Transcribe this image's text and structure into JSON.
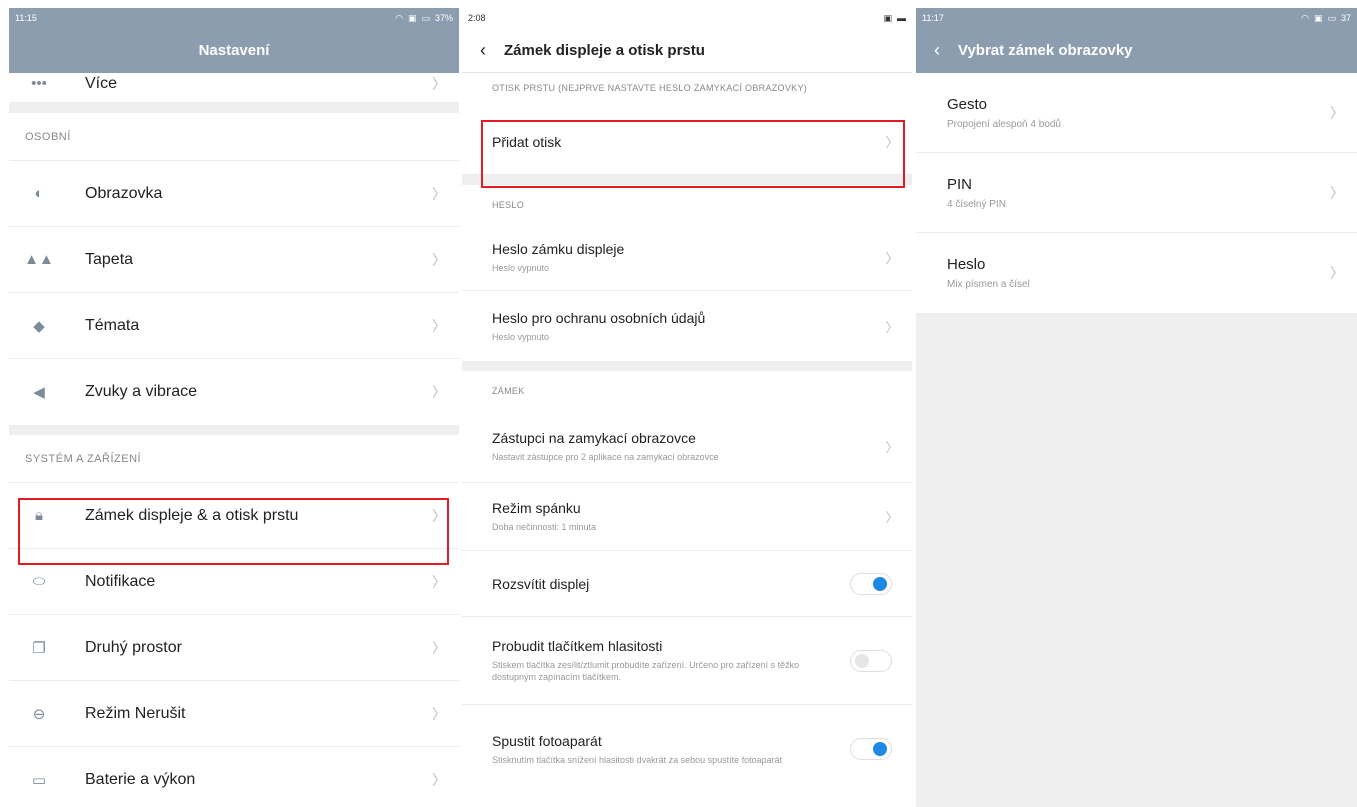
{
  "panel1": {
    "status_time": "11:15",
    "status_battery": "37%",
    "title": "Nastavení",
    "top_item": "Více",
    "section_personal": "OSOBNÍ",
    "personal_items": [
      {
        "label": "Obrazovka",
        "icon": "contrast-icon"
      },
      {
        "label": "Tapeta",
        "icon": "mountain-icon"
      },
      {
        "label": "Témata",
        "icon": "brush-icon"
      },
      {
        "label": "Zvuky a vibrace",
        "icon": "speaker-icon"
      }
    ],
    "section_system": "SYSTÉM A ZAŘÍZENÍ",
    "system_items": [
      {
        "label": "Zámek displeje & a otisk prstu",
        "icon": "lock-icon"
      },
      {
        "label": "Notifikace",
        "icon": "toggle-icon"
      },
      {
        "label": "Druhý prostor",
        "icon": "copy-icon"
      },
      {
        "label": "Režim Nerušit",
        "icon": "minus-circle-icon"
      },
      {
        "label": "Baterie a výkon",
        "icon": "battery-icon"
      }
    ]
  },
  "panel2": {
    "status_time": "2:08",
    "title": "Zámek displeje a otisk prstu",
    "section_fingerprint": "OTISK PRSTU (NEJPRVE NASTAVTE HESLO ZAMYKACÍ OBRAZOVKY)",
    "add_fingerprint": "Přidat otisk",
    "section_password": "HESLO",
    "lock_password": {
      "title": "Heslo zámku displeje",
      "sub": "Heslo vypnuto"
    },
    "privacy_password": {
      "title": "Heslo pro ochranu osobních údajů",
      "sub": "Heslo vypnuto"
    },
    "section_lock": "ZÁMEK",
    "shortcuts": {
      "title": "Zástupci na zamykací obrazovce",
      "sub": "Nastavit zástupce pro 2 aplikace na zamykací obrazovce"
    },
    "sleep": {
      "title": "Režim spánku",
      "sub": "Doba nečinnosti: 1 minuta"
    },
    "wake_display": {
      "title": "Rozsvítit displej",
      "on": true
    },
    "volume_wake": {
      "title": "Probudit tlačítkem hlasitosti",
      "sub": "Stiskem tlačítka zesílit/ztlumit probudíte zařízení. Určeno pro zařízení s těžko dostupným zapínacím tlačítkem.",
      "on": false
    },
    "camera": {
      "title": "Spustit fotoaparát",
      "sub": "Stisknutím tlačítka snížení hlasitosti dvakrát za sebou spustíte fotoaparát",
      "on": true
    }
  },
  "panel3": {
    "status_time": "11:17",
    "status_battery": "37",
    "title": "Vybrat zámek obrazovky",
    "options": [
      {
        "title": "Gesto",
        "sub": "Propojení alespoň 4 bodů"
      },
      {
        "title": "PIN",
        "sub": "4 číselný PIN"
      },
      {
        "title": "Heslo",
        "sub": "Mix písmen a čísel"
      }
    ]
  },
  "colors": {
    "header": "#8d9db0",
    "highlight": "#e31b23",
    "toggle_on": "#1e88e5"
  }
}
